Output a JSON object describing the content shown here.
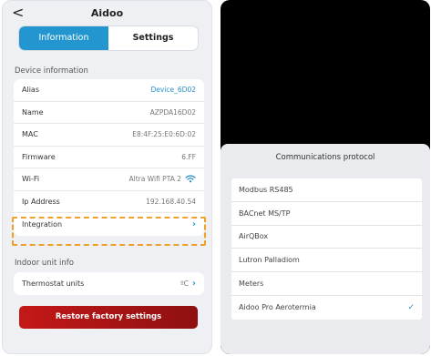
{
  "left_screen": {
    "header": {
      "back_symbol": "<",
      "title": "Aidoo"
    },
    "tabs": [
      {
        "label": "Information",
        "active": true
      },
      {
        "label": "Settings",
        "active": false
      }
    ],
    "device_info": {
      "section_label": "Device information",
      "rows": [
        {
          "label": "Alias",
          "value": "Device_6D02"
        },
        {
          "label": "Name",
          "value": "AZPDA16D02"
        },
        {
          "label": "MAC",
          "value": "E8:4F:25:E0:6D:02"
        },
        {
          "label": "Firmware",
          "value": "6.FF"
        },
        {
          "label": "Wi-Fi",
          "value": "Altra Wifi PTA 2",
          "icon": "wifi-icon"
        },
        {
          "label": "Ip Address",
          "value": "192.168.40.54"
        },
        {
          "label": "Integration",
          "value": "",
          "icon": "chevron-right-icon"
        }
      ]
    },
    "indoor_unit": {
      "section_label": "Indoor unit info",
      "rows": [
        {
          "label": "Thermostat units",
          "value": "ºC",
          "icon": "chevron-right-icon"
        }
      ]
    },
    "restore_button": "Restore factory settings",
    "colors": {
      "accent": "#2496cf",
      "highlight": "#f0a02a",
      "danger": "#c41818"
    }
  },
  "right_screen": {
    "sheet_title": "Communications protocol",
    "options": [
      {
        "label": "Modbus RS485",
        "selected": false
      },
      {
        "label": "BACnet MS/TP",
        "selected": false
      },
      {
        "label": "AirQBox",
        "selected": false
      },
      {
        "label": "Lutron Palladiom",
        "selected": false
      },
      {
        "label": "Meters",
        "selected": false
      },
      {
        "label": "Aidoo Pro Aerotermia",
        "selected": true
      }
    ],
    "check_symbol": "✓"
  }
}
